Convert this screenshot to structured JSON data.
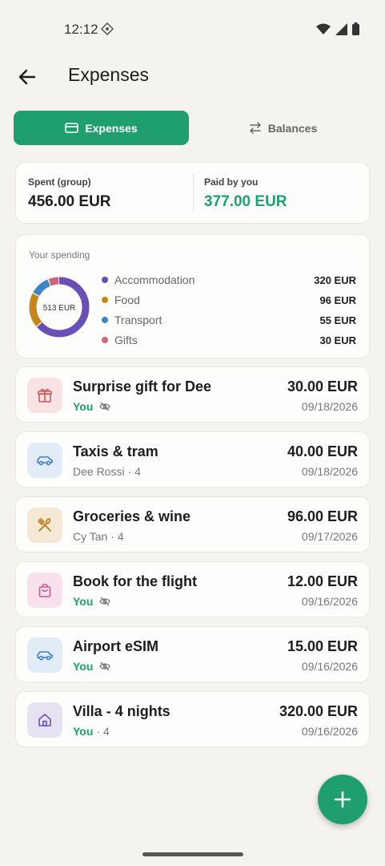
{
  "status": {
    "time": "12:12"
  },
  "appbar": {
    "title": "Expenses"
  },
  "tabs": [
    {
      "label": "Expenses",
      "icon": "card-icon",
      "active": true
    },
    {
      "label": "Balances",
      "icon": "swap-arrows-icon",
      "active": false
    }
  ],
  "summary": {
    "spent_label": "Spent (group)",
    "spent_value": "456.00 EUR",
    "paid_label": "Paid by you",
    "paid_value": "377.00 EUR",
    "paid_color": "#1f9e70"
  },
  "spending": {
    "title": "Your spending",
    "total": "513 EUR",
    "categories": [
      {
        "name": "Accommodation",
        "amount": "320 EUR",
        "value": 320,
        "color": "#6a4fb7"
      },
      {
        "name": "Food",
        "amount": "96 EUR",
        "value": 96,
        "color": "#c4861a"
      },
      {
        "name": "Transport",
        "amount": "55 EUR",
        "value": 55,
        "color": "#3f86c8"
      },
      {
        "name": "Gifts",
        "amount": "30 EUR",
        "value": 30,
        "color": "#d0647a"
      }
    ]
  },
  "expenses": [
    {
      "title": "Surprise gift for Dee",
      "payer": "You",
      "suffix": "",
      "hidden": true,
      "amount": "30.00 EUR",
      "date": "09/18/2026",
      "icon": "gift-icon",
      "icon_bg": "#f7e3e3",
      "icon_color": "#c95a5a"
    },
    {
      "title": "Taxis & tram",
      "payer": "Dee Rossi",
      "suffix": " · 4",
      "hidden": false,
      "amount": "40.00 EUR",
      "date": "09/18/2026",
      "icon": "car-icon",
      "icon_bg": "#e1ecf7",
      "icon_color": "#3f7fc0"
    },
    {
      "title": "Groceries & wine",
      "payer": "Cy Tan",
      "suffix": " · 4",
      "hidden": false,
      "amount": "96.00 EUR",
      "date": "09/17/2026",
      "icon": "utensils-icon",
      "icon_bg": "#f5e8d4",
      "icon_color": "#b8791a"
    },
    {
      "title": "Book for the flight",
      "payer": "You",
      "suffix": "",
      "hidden": true,
      "amount": "12.00 EUR",
      "date": "09/16/2026",
      "icon": "shopping-bag-icon",
      "icon_bg": "#f8e1ec",
      "icon_color": "#c45a8e"
    },
    {
      "title": "Airport eSIM",
      "payer": "You",
      "suffix": "",
      "hidden": true,
      "amount": "15.00 EUR",
      "date": "09/16/2026",
      "icon": "car-icon",
      "icon_bg": "#e1ecf7",
      "icon_color": "#3f7fc0"
    },
    {
      "title": "Villa - 4 nights",
      "payer": "You",
      "suffix": " · 4",
      "hidden": false,
      "amount": "320.00 EUR",
      "date": "09/16/2026",
      "icon": "home-icon",
      "icon_bg": "#e6e2f2",
      "icon_color": "#6a4fb7"
    }
  ],
  "colors": {
    "accent": "#1f9e70",
    "background": "#f4f3f0"
  }
}
